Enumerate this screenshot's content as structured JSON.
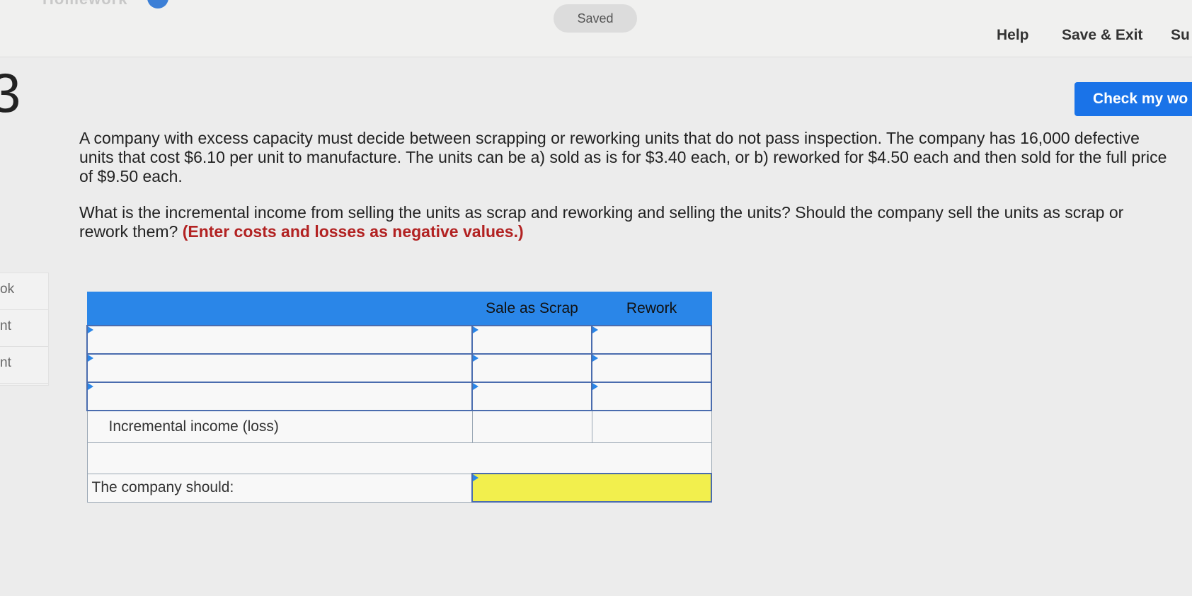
{
  "topbar": {
    "title_fragment": "Homework",
    "saved_label": "Saved",
    "help_label": "Help",
    "save_exit_label": "Save & Exit",
    "submit_label": "Su"
  },
  "check_button_label": "Check my wo",
  "question_number": "3",
  "left_nav": [
    "ok",
    "nt",
    "nt"
  ],
  "question": {
    "paragraph1": "A company with excess capacity must decide between scrapping or reworking units that do not pass inspection. The company has 16,000 defective units that cost $6.10 per unit to manufacture. The units can be a) sold as is for $3.40 each, or b) reworked for $4.50 each and then sold for the full price of $9.50 each.",
    "paragraph2": "What is the incremental income from selling the units as scrap and reworking and selling the units? Should the company sell the units as scrap or rework them?",
    "instruction": "(Enter costs and losses as negative values.)"
  },
  "table": {
    "col1_header": "Sale as Scrap",
    "col2_header": "Rework",
    "incremental_label": "Incremental income (loss)",
    "company_should_label": "The company should:"
  },
  "colors": {
    "accent_blue": "#2a86e8",
    "button_blue": "#1a73e8",
    "instruction_red": "#b22222",
    "answer_yellow": "#f2ef4d"
  }
}
